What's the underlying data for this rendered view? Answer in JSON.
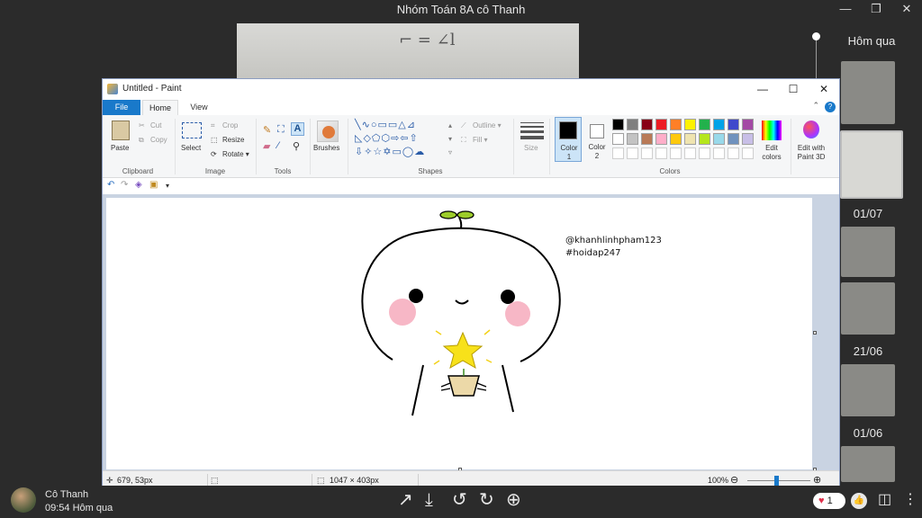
{
  "viewer": {
    "title": "Nhóm Toán 8A cô Thanh",
    "controls": {
      "minimize": "—",
      "restore": "❐",
      "close": "✕"
    },
    "timeline": {
      "labels": [
        "Hôm qua",
        "01/07",
        "21/06",
        "01/06"
      ]
    },
    "bottom": {
      "user_name": "Cô Thanh",
      "user_time": "09:54 Hôm qua",
      "reaction_count": "1",
      "icons": [
        "share-icon",
        "download-icon",
        "rotate-left-icon",
        "rotate-right-icon",
        "zoom-in-icon",
        "like-icon",
        "layout-icon",
        "more-icon"
      ]
    }
  },
  "paint": {
    "title": "Untitled - Paint",
    "tabs": {
      "file": "File",
      "home": "Home",
      "view": "View"
    },
    "help": "?",
    "clipboard": {
      "paste": "Paste",
      "cut": "Cut",
      "copy": "Copy",
      "label": "Clipboard"
    },
    "image": {
      "select": "Select",
      "crop": "Crop",
      "resize": "Resize",
      "rotate": "Rotate",
      "label": "Image"
    },
    "tools": {
      "label": "Tools"
    },
    "brushes": "Brushes",
    "shapes": {
      "outline": "Outline",
      "fill": "Fill",
      "label": "Shapes"
    },
    "size": "Size",
    "colors": {
      "color1_label": "Color",
      "color1_num": "1",
      "color2_label": "Color",
      "color2_num": "2",
      "edit": "Edit",
      "edit2": "colors",
      "paint3d": "Edit with",
      "paint3d2": "Paint 3D",
      "label": "Colors",
      "palette_row1": [
        "#000000",
        "#7f7f7f",
        "#880015",
        "#ed1c24",
        "#ff7f27",
        "#fff200",
        "#22b14c",
        "#00a2e8",
        "#3f48cc",
        "#a349a4"
      ],
      "palette_row2": [
        "#ffffff",
        "#c3c3c3",
        "#b97a57",
        "#ffaec9",
        "#ffc90e",
        "#efe4b0",
        "#b5e61d",
        "#99d9ea",
        "#7092be",
        "#c8bfe7"
      ]
    },
    "canvas_text": {
      "line1": "@khanhlinhpham123",
      "line2": "#hoidap247"
    },
    "status": {
      "cursor": "679, 53px",
      "size": "1047 × 403px",
      "zoom": "100%"
    }
  }
}
